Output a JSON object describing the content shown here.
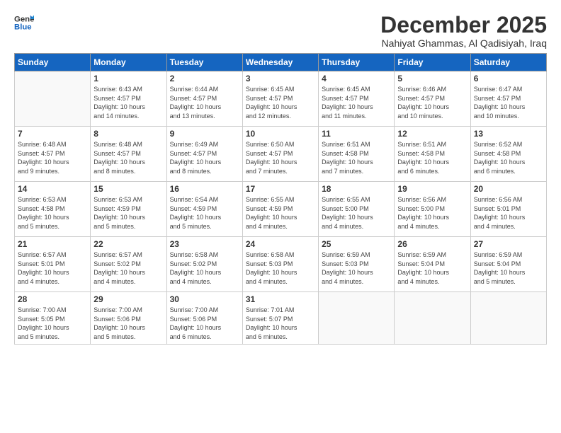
{
  "logo": {
    "line1": "General",
    "line2": "Blue"
  },
  "title": "December 2025",
  "location": "Nahiyat Ghammas, Al Qadisiyah, Iraq",
  "headers": [
    "Sunday",
    "Monday",
    "Tuesday",
    "Wednesday",
    "Thursday",
    "Friday",
    "Saturday"
  ],
  "weeks": [
    [
      {
        "day": "",
        "info": ""
      },
      {
        "day": "1",
        "info": "Sunrise: 6:43 AM\nSunset: 4:57 PM\nDaylight: 10 hours\nand 14 minutes."
      },
      {
        "day": "2",
        "info": "Sunrise: 6:44 AM\nSunset: 4:57 PM\nDaylight: 10 hours\nand 13 minutes."
      },
      {
        "day": "3",
        "info": "Sunrise: 6:45 AM\nSunset: 4:57 PM\nDaylight: 10 hours\nand 12 minutes."
      },
      {
        "day": "4",
        "info": "Sunrise: 6:45 AM\nSunset: 4:57 PM\nDaylight: 10 hours\nand 11 minutes."
      },
      {
        "day": "5",
        "info": "Sunrise: 6:46 AM\nSunset: 4:57 PM\nDaylight: 10 hours\nand 10 minutes."
      },
      {
        "day": "6",
        "info": "Sunrise: 6:47 AM\nSunset: 4:57 PM\nDaylight: 10 hours\nand 10 minutes."
      }
    ],
    [
      {
        "day": "7",
        "info": "Sunrise: 6:48 AM\nSunset: 4:57 PM\nDaylight: 10 hours\nand 9 minutes."
      },
      {
        "day": "8",
        "info": "Sunrise: 6:48 AM\nSunset: 4:57 PM\nDaylight: 10 hours\nand 8 minutes."
      },
      {
        "day": "9",
        "info": "Sunrise: 6:49 AM\nSunset: 4:57 PM\nDaylight: 10 hours\nand 8 minutes."
      },
      {
        "day": "10",
        "info": "Sunrise: 6:50 AM\nSunset: 4:57 PM\nDaylight: 10 hours\nand 7 minutes."
      },
      {
        "day": "11",
        "info": "Sunrise: 6:51 AM\nSunset: 4:58 PM\nDaylight: 10 hours\nand 7 minutes."
      },
      {
        "day": "12",
        "info": "Sunrise: 6:51 AM\nSunset: 4:58 PM\nDaylight: 10 hours\nand 6 minutes."
      },
      {
        "day": "13",
        "info": "Sunrise: 6:52 AM\nSunset: 4:58 PM\nDaylight: 10 hours\nand 6 minutes."
      }
    ],
    [
      {
        "day": "14",
        "info": "Sunrise: 6:53 AM\nSunset: 4:58 PM\nDaylight: 10 hours\nand 5 minutes."
      },
      {
        "day": "15",
        "info": "Sunrise: 6:53 AM\nSunset: 4:59 PM\nDaylight: 10 hours\nand 5 minutes."
      },
      {
        "day": "16",
        "info": "Sunrise: 6:54 AM\nSunset: 4:59 PM\nDaylight: 10 hours\nand 5 minutes."
      },
      {
        "day": "17",
        "info": "Sunrise: 6:55 AM\nSunset: 4:59 PM\nDaylight: 10 hours\nand 4 minutes."
      },
      {
        "day": "18",
        "info": "Sunrise: 6:55 AM\nSunset: 5:00 PM\nDaylight: 10 hours\nand 4 minutes."
      },
      {
        "day": "19",
        "info": "Sunrise: 6:56 AM\nSunset: 5:00 PM\nDaylight: 10 hours\nand 4 minutes."
      },
      {
        "day": "20",
        "info": "Sunrise: 6:56 AM\nSunset: 5:01 PM\nDaylight: 10 hours\nand 4 minutes."
      }
    ],
    [
      {
        "day": "21",
        "info": "Sunrise: 6:57 AM\nSunset: 5:01 PM\nDaylight: 10 hours\nand 4 minutes."
      },
      {
        "day": "22",
        "info": "Sunrise: 6:57 AM\nSunset: 5:02 PM\nDaylight: 10 hours\nand 4 minutes."
      },
      {
        "day": "23",
        "info": "Sunrise: 6:58 AM\nSunset: 5:02 PM\nDaylight: 10 hours\nand 4 minutes."
      },
      {
        "day": "24",
        "info": "Sunrise: 6:58 AM\nSunset: 5:03 PM\nDaylight: 10 hours\nand 4 minutes."
      },
      {
        "day": "25",
        "info": "Sunrise: 6:59 AM\nSunset: 5:03 PM\nDaylight: 10 hours\nand 4 minutes."
      },
      {
        "day": "26",
        "info": "Sunrise: 6:59 AM\nSunset: 5:04 PM\nDaylight: 10 hours\nand 4 minutes."
      },
      {
        "day": "27",
        "info": "Sunrise: 6:59 AM\nSunset: 5:04 PM\nDaylight: 10 hours\nand 5 minutes."
      }
    ],
    [
      {
        "day": "28",
        "info": "Sunrise: 7:00 AM\nSunset: 5:05 PM\nDaylight: 10 hours\nand 5 minutes."
      },
      {
        "day": "29",
        "info": "Sunrise: 7:00 AM\nSunset: 5:06 PM\nDaylight: 10 hours\nand 5 minutes."
      },
      {
        "day": "30",
        "info": "Sunrise: 7:00 AM\nSunset: 5:06 PM\nDaylight: 10 hours\nand 6 minutes."
      },
      {
        "day": "31",
        "info": "Sunrise: 7:01 AM\nSunset: 5:07 PM\nDaylight: 10 hours\nand 6 minutes."
      },
      {
        "day": "",
        "info": ""
      },
      {
        "day": "",
        "info": ""
      },
      {
        "day": "",
        "info": ""
      }
    ]
  ]
}
